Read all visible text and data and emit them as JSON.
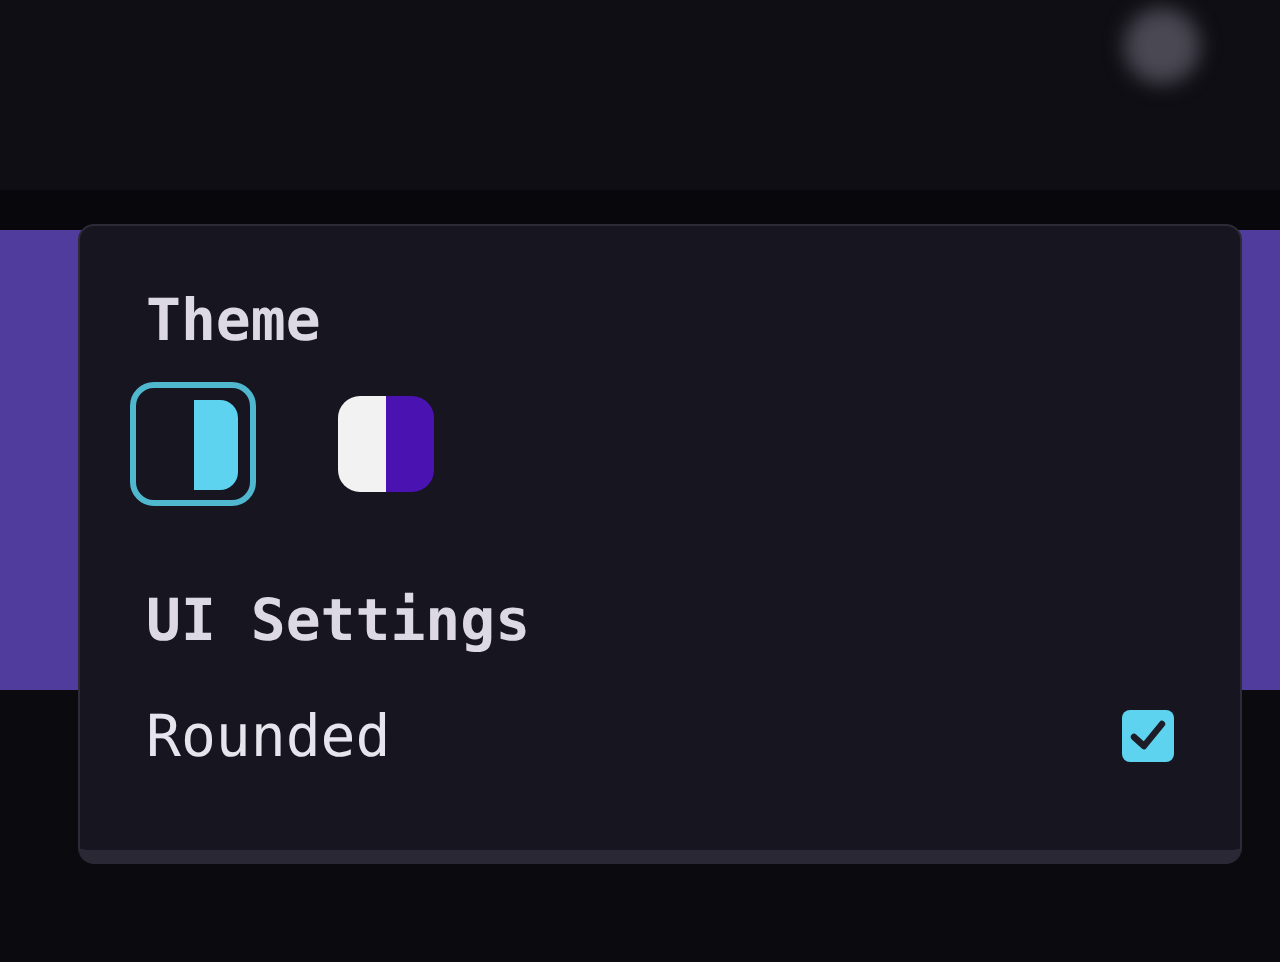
{
  "theme": {
    "title": "Theme",
    "options": [
      {
        "kind": "dark",
        "color": "#5dd3f0",
        "selected": true
      },
      {
        "kind": "light",
        "color": "#4a12b0",
        "selected": false
      }
    ]
  },
  "ui_settings": {
    "title": "UI Settings",
    "options": [
      {
        "label": "Rounded",
        "checked": true
      }
    ]
  }
}
